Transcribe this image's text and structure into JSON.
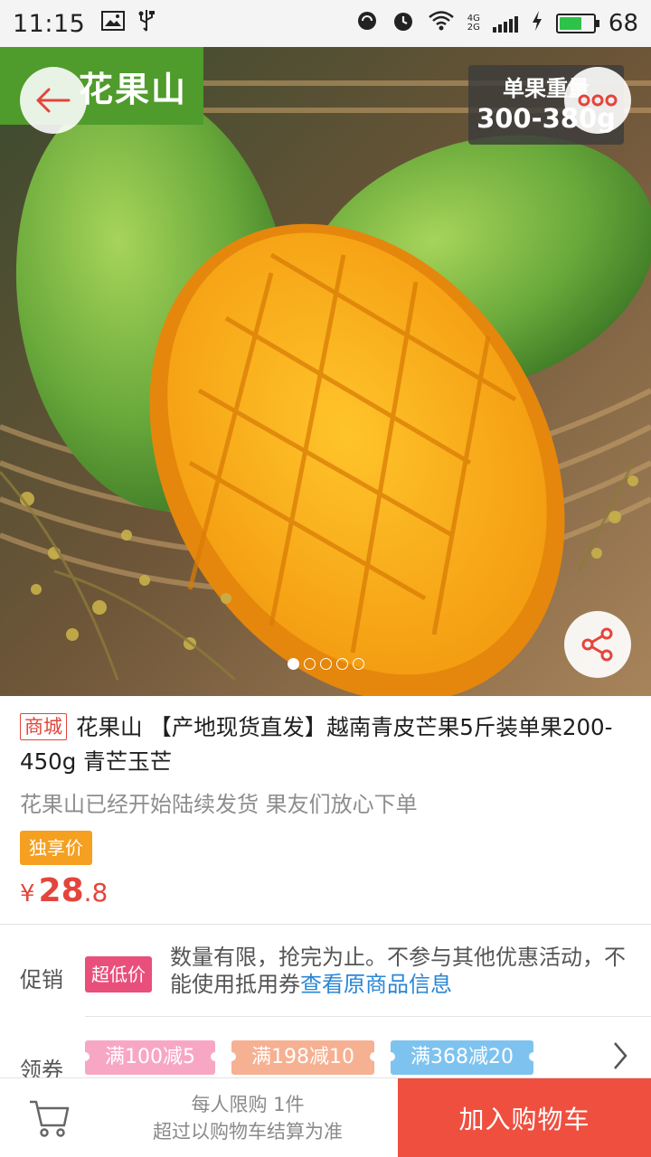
{
  "status_bar": {
    "time": "11:15",
    "battery": "68",
    "battery_level": 0.68,
    "net_top": "4G",
    "net_bottom": "2G",
    "icons": [
      "image-icon",
      "usb-icon",
      "sync-icon",
      "alarm-icon",
      "wifi-icon",
      "signal-icon",
      "charging-icon",
      "battery-icon"
    ]
  },
  "hero": {
    "brand": "花果山",
    "weight_line1": "单果重量",
    "weight_line2": "300-380g",
    "carousel_count": 5,
    "carousel_active": 1
  },
  "product": {
    "badge": "商城",
    "title": "花果山 【产地现货直发】越南青皮芒果5斤装单果200-450g 青芒玉芒",
    "subtitle": "花果山已经开始陆续发货 果友们放心下单",
    "exclusive_label": "独享价",
    "currency": "¥",
    "price_int": "28",
    "price_dec": ".8"
  },
  "promo": {
    "label": "促销",
    "tag": "超低价",
    "text": "数量有限，抢完为止。不参与其他优惠活动，不能使用抵用券",
    "link": "查看原商品信息"
  },
  "coupons": {
    "label": "领券",
    "items": [
      "满100减5",
      "满198减10",
      "满368减20"
    ]
  },
  "bottom_bar": {
    "limit_line1": "每人限购 1件",
    "limit_line2": "超过以购物车结算为准",
    "add_to_cart": "加入购物车"
  },
  "colors": {
    "brand_green": "#4f9b2c",
    "accent_red": "#e3453c",
    "exclusive_orange": "#f5a020",
    "low_price_pink": "#e94f7b",
    "link_blue": "#2a86d6"
  }
}
